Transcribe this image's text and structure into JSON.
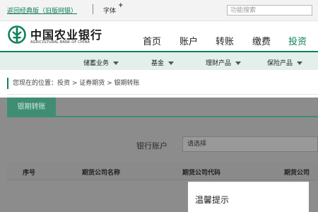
{
  "topbar": {
    "classic_link": "返回经典版（旧版网银）",
    "font_label": "字体",
    "font_plus": "+",
    "search_placeholder": "功能搜索"
  },
  "header": {
    "brand_cn": "中国农业银行",
    "brand_en": "AGRICULTURAL BANK OF CHINA",
    "nav": [
      "首页",
      "账户",
      "转账",
      "缴费",
      "投资"
    ],
    "active_nav": "投资",
    "accent_color": "#0e7f5c"
  },
  "subnav": [
    "储蓄业务",
    "基金",
    "理财产品",
    "保险产品"
  ],
  "breadcrumb": "您现在的位置：投资 > 证券期货 > 银期转账",
  "main": {
    "tab": "银期转账",
    "account_label": "银行账户",
    "account_select": "请选择",
    "columns": [
      "序号",
      "期货公司名称",
      "期货公司代码",
      "期货公司"
    ]
  },
  "dialog": {
    "title": "温馨提示"
  }
}
